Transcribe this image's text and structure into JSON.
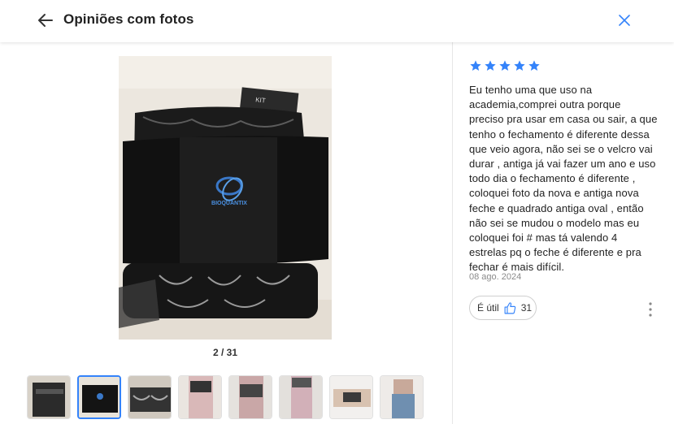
{
  "header": {
    "title": "Opiniões com fotos",
    "back_icon": "arrow-left-icon",
    "close_icon": "close-icon"
  },
  "gallery": {
    "counter": "2 / 31",
    "current_index": 2,
    "total": 31,
    "photo_logo_text": "BIOQUANTIX",
    "photo_label_text": "KIT",
    "thumbnail_count": 8,
    "selected_thumbnail": 2
  },
  "review": {
    "rating": 5,
    "max_rating": 5,
    "text": "Eu tenho uma que uso na academia,comprei outra porque preciso pra usar em casa ou sair, a que tenho o fechamento é diferente dessa que veio agora, não sei se o velcro vai durar , antiga já vai fazer um ano e uso todo dia o fechamento é diferente , coloquei foto da nova e antiga nova feche e quadrado antiga oval , então não sei se mudou o modelo mas eu coloquei foi # mas tá valendo 4 estrelas pq o feche é diferente e pra fechar é mais difícil.",
    "date": "08 ago. 2024",
    "useful_label": "É útil",
    "useful_count": "31",
    "more_icon": "more-vertical-icon"
  },
  "colors": {
    "accent": "#3483fa",
    "star": "#3483fa",
    "text": "#222222",
    "muted": "#8a8a8a"
  }
}
